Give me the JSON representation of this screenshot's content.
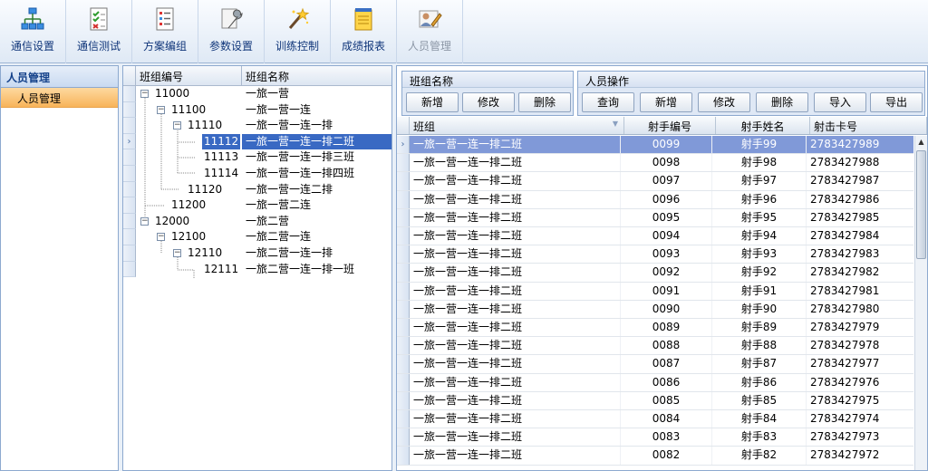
{
  "toolbar": {
    "items": [
      {
        "label": "通信设置",
        "icon": "network-icon",
        "enabled": true
      },
      {
        "label": "通信测试",
        "icon": "checklist-icon",
        "enabled": true
      },
      {
        "label": "方案编组",
        "icon": "list-icon",
        "enabled": true
      },
      {
        "label": "参数设置",
        "icon": "wrench-icon",
        "enabled": true
      },
      {
        "label": "训练控制",
        "icon": "magic-wand-icon",
        "enabled": true
      },
      {
        "label": "成绩报表",
        "icon": "notepad-icon",
        "enabled": true
      },
      {
        "label": "人员管理",
        "icon": "user-edit-icon",
        "enabled": false
      }
    ]
  },
  "leftnav": {
    "header": "人员管理",
    "items": [
      "人员管理"
    ]
  },
  "tree": {
    "columns": [
      "班组编号",
      "班组名称"
    ],
    "rows": [
      {
        "code": "11000",
        "name": "一旅一营",
        "level": 0,
        "expander": "−"
      },
      {
        "code": "11100",
        "name": "一旅一营一连",
        "level": 1,
        "expander": "−"
      },
      {
        "code": "11110",
        "name": "一旅一营一连一排",
        "level": 2,
        "expander": "−"
      },
      {
        "code": "11112",
        "name": "一旅一营一连一排二班",
        "level": 3,
        "expander": "",
        "selected": true
      },
      {
        "code": "11113",
        "name": "一旅一营一连一排三班",
        "level": 3,
        "expander": ""
      },
      {
        "code": "11114",
        "name": "一旅一营一连一排四班",
        "level": 3,
        "expander": ""
      },
      {
        "code": "11120",
        "name": "一旅一营一连二排",
        "level": 2,
        "expander": ""
      },
      {
        "code": "11200",
        "name": "一旅一营二连",
        "level": 1,
        "expander": ""
      },
      {
        "code": "12000",
        "name": "一旅二营",
        "level": 0,
        "expander": "−"
      },
      {
        "code": "12100",
        "name": "一旅二营一连",
        "level": 1,
        "expander": "−"
      },
      {
        "code": "12110",
        "name": "一旅二营一连一排",
        "level": 2,
        "expander": "−"
      },
      {
        "code": "12111",
        "name": "一旅二营一连一排一班",
        "level": 3,
        "expander": ""
      }
    ]
  },
  "group_box": {
    "title": "班组名称",
    "buttons": [
      "新增",
      "修改",
      "删除"
    ]
  },
  "person_box": {
    "title": "人员操作",
    "buttons": [
      "查询",
      "新增",
      "修改",
      "删除",
      "导入",
      "导出"
    ]
  },
  "grid": {
    "columns": [
      "班组",
      "射手编号",
      "射手姓名",
      "射击卡号"
    ],
    "rows": [
      [
        "一旅一营一连一排二班",
        "0099",
        "射手99",
        "2783427989"
      ],
      [
        "一旅一营一连一排二班",
        "0098",
        "射手98",
        "2783427988"
      ],
      [
        "一旅一营一连一排二班",
        "0097",
        "射手97",
        "2783427987"
      ],
      [
        "一旅一营一连一排二班",
        "0096",
        "射手96",
        "2783427986"
      ],
      [
        "一旅一营一连一排二班",
        "0095",
        "射手95",
        "2783427985"
      ],
      [
        "一旅一营一连一排二班",
        "0094",
        "射手94",
        "2783427984"
      ],
      [
        "一旅一营一连一排二班",
        "0093",
        "射手93",
        "2783427983"
      ],
      [
        "一旅一营一连一排二班",
        "0092",
        "射手92",
        "2783427982"
      ],
      [
        "一旅一营一连一排二班",
        "0091",
        "射手91",
        "2783427981"
      ],
      [
        "一旅一营一连一排二班",
        "0090",
        "射手90",
        "2783427980"
      ],
      [
        "一旅一营一连一排二班",
        "0089",
        "射手89",
        "2783427979"
      ],
      [
        "一旅一营一连一排二班",
        "0088",
        "射手88",
        "2783427978"
      ],
      [
        "一旅一营一连一排二班",
        "0087",
        "射手87",
        "2783427977"
      ],
      [
        "一旅一营一连一排二班",
        "0086",
        "射手86",
        "2783427976"
      ],
      [
        "一旅一营一连一排二班",
        "0085",
        "射手85",
        "2783427975"
      ],
      [
        "一旅一营一连一排二班",
        "0084",
        "射手84",
        "2783427974"
      ],
      [
        "一旅一营一连一排二班",
        "0083",
        "射手83",
        "2783427973"
      ],
      [
        "一旅一营一连一排二班",
        "0082",
        "射手82",
        "2783427972"
      ]
    ]
  },
  "colors": {
    "tree_selection": "#3969c3",
    "grid_selection": "#8099d8",
    "nav_highlight": "#f8b45a"
  }
}
